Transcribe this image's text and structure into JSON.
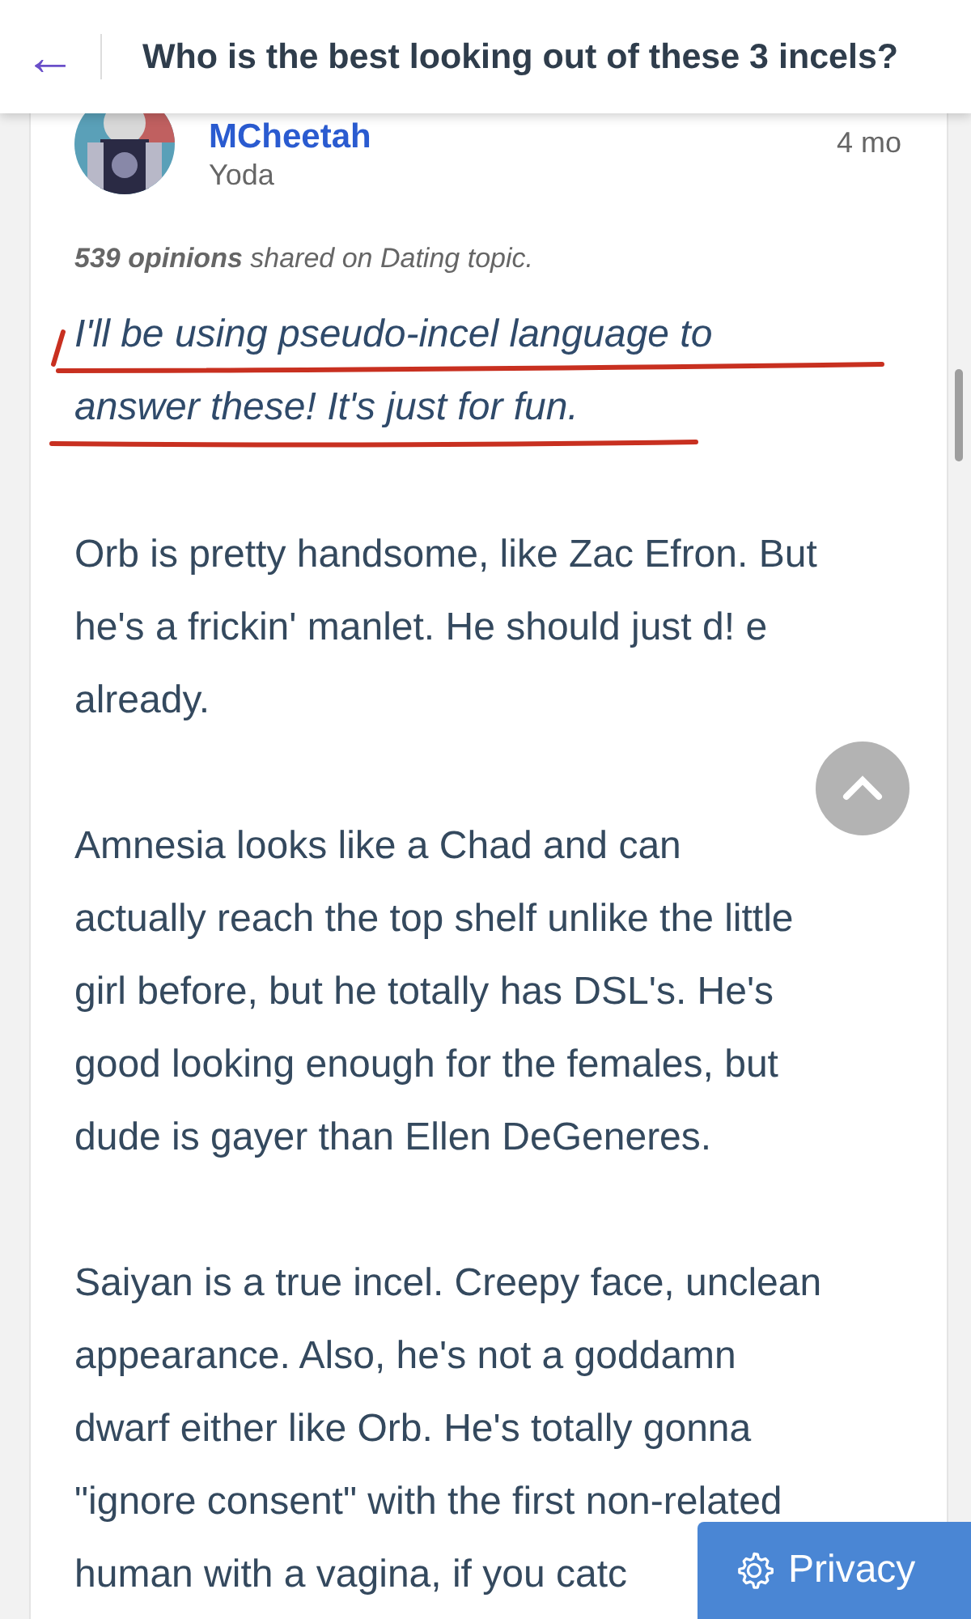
{
  "header": {
    "back_icon": "←",
    "title": "Who is the best looking out of these 3 incels?"
  },
  "post": {
    "username": "MCheetah",
    "rank": "Yoda",
    "time": "4 mo",
    "opinions_count": "539 opinions",
    "opinions_rest": " shared on Dating topic.",
    "quote_lines": [
      "I'll be using pseudo-incel language to",
      "answer these! It's just for fun."
    ],
    "paragraphs": [
      {
        "lines": [
          "Orb is pretty handsome, like Zac Efron. But",
          "he's a frickin' manlet. He should just d! e",
          "already."
        ]
      },
      {
        "lines": [
          "Amnesia looks like a Chad and can",
          "actually reach the top shelf unlike the little",
          "girl before, but he totally has DSL's. He's",
          "good looking enough for the females, but",
          "dude is gayer than Ellen DeGeneres."
        ]
      },
      {
        "lines": [
          "Saiyan is a true incel. Creepy face, unclean",
          "appearance. Also, he's not a goddamn",
          "dwarf either like Orb. He's totally gonna",
          "\"ignore consent\" with the first non-related",
          "human with a vagina, if you catc"
        ]
      }
    ]
  },
  "privacy_button": {
    "label": "Privacy"
  }
}
